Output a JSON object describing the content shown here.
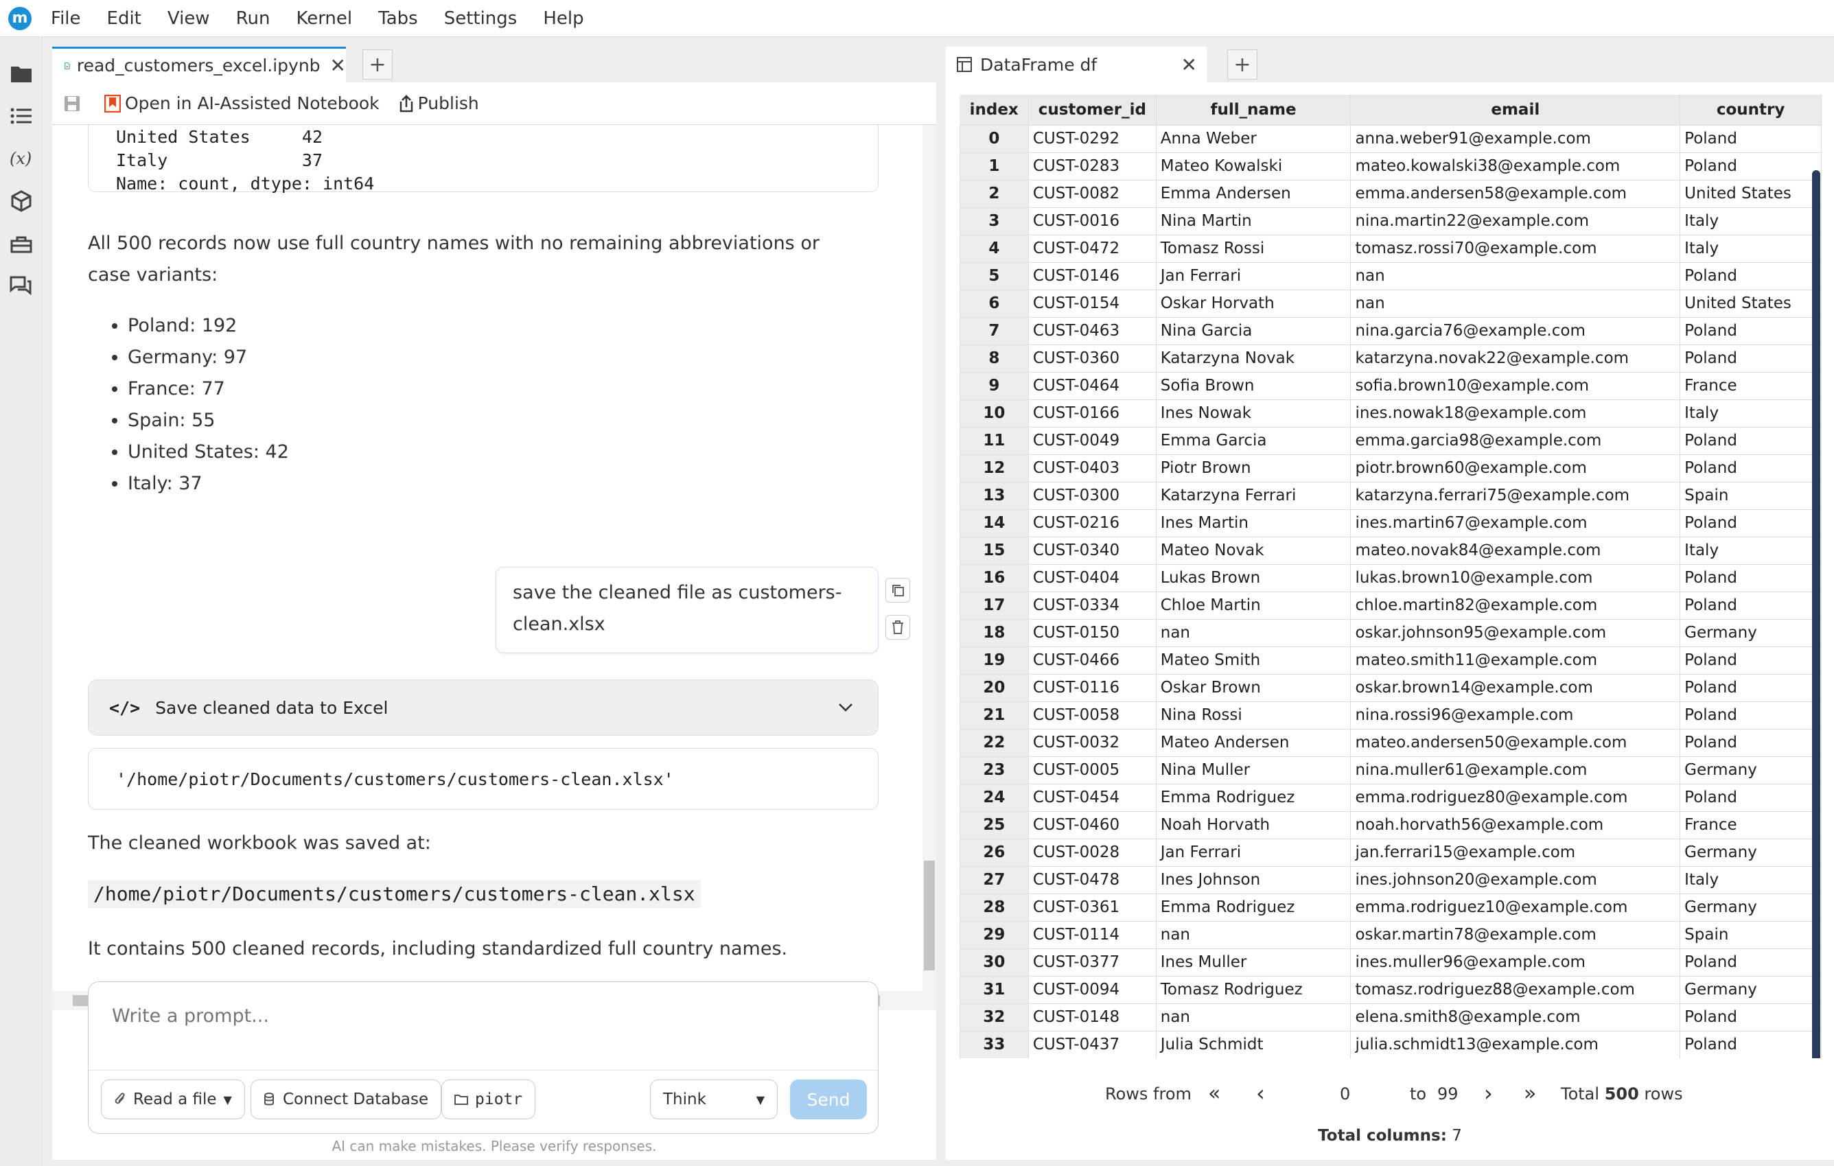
{
  "menu": [
    "File",
    "Edit",
    "View",
    "Run",
    "Kernel",
    "Tabs",
    "Settings",
    "Help"
  ],
  "logo_letter": "m",
  "notebook": {
    "tab_title": "read_customers_excel.ipynb",
    "toolbar": {
      "open_ai": "Open in AI-Assisted Notebook",
      "publish": "Publish"
    },
    "output_lines": [
      "United States     42",
      "Italy             37",
      "Name: count, dtype: int64"
    ],
    "summary": "All 500 records now use full country names with no remaining abbreviations or case variants:",
    "countries": [
      "Poland: 192",
      "Germany: 97",
      "France: 77",
      "Spain: 55",
      "United States: 42",
      "Italy: 37"
    ],
    "user_message": "save the cleaned file as customers-clean.xlsx",
    "code_cell_title": "Save cleaned data to Excel",
    "code_output": "'/home/piotr/Documents/customers/customers-clean.xlsx'",
    "saved_at_text": "The cleaned workbook was saved at:",
    "saved_path": "/home/piotr/Documents/customers/customers-clean.xlsx",
    "contains_text": "It contains 500 cleaned records, including standardized full country names.",
    "prompt_placeholder": "Write a prompt...",
    "buttons": {
      "read_file": "Read a file",
      "connect_db": "Connect Database",
      "user": "piotr",
      "think": "Think",
      "send": "Send"
    },
    "disclaimer": "AI can make mistakes. Please verify responses."
  },
  "dataframe": {
    "tab_title": "DataFrame df",
    "columns": [
      "index",
      "customer_id",
      "full_name",
      "email",
      "country"
    ],
    "rows": [
      [
        "0",
        "CUST-0292",
        "Anna Weber",
        "anna.weber91@example.com",
        "Poland"
      ],
      [
        "1",
        "CUST-0283",
        "Mateo Kowalski",
        "mateo.kowalski38@example.com",
        "Poland"
      ],
      [
        "2",
        "CUST-0082",
        "Emma Andersen",
        "emma.andersen58@example.com",
        "United States"
      ],
      [
        "3",
        "CUST-0016",
        "Nina Martin",
        "nina.martin22@example.com",
        "Italy"
      ],
      [
        "4",
        "CUST-0472",
        "Tomasz Rossi",
        "tomasz.rossi70@example.com",
        "Italy"
      ],
      [
        "5",
        "CUST-0146",
        "Jan Ferrari",
        "nan",
        "Poland"
      ],
      [
        "6",
        "CUST-0154",
        "Oskar Horvath",
        "nan",
        "United States"
      ],
      [
        "7",
        "CUST-0463",
        "Nina Garcia",
        "nina.garcia76@example.com",
        "Poland"
      ],
      [
        "8",
        "CUST-0360",
        "Katarzyna Novak",
        "katarzyna.novak22@example.com",
        "Poland"
      ],
      [
        "9",
        "CUST-0464",
        "Sofia Brown",
        "sofia.brown10@example.com",
        "France"
      ],
      [
        "10",
        "CUST-0166",
        "Ines Nowak",
        "ines.nowak18@example.com",
        "Italy"
      ],
      [
        "11",
        "CUST-0049",
        "Emma Garcia",
        "emma.garcia98@example.com",
        "Poland"
      ],
      [
        "12",
        "CUST-0403",
        "Piotr Brown",
        "piotr.brown60@example.com",
        "Poland"
      ],
      [
        "13",
        "CUST-0300",
        "Katarzyna Ferrari",
        "katarzyna.ferrari75@example.com",
        "Spain"
      ],
      [
        "14",
        "CUST-0216",
        "Ines Martin",
        "ines.martin67@example.com",
        "Poland"
      ],
      [
        "15",
        "CUST-0340",
        "Mateo Novak",
        "mateo.novak84@example.com",
        "Italy"
      ],
      [
        "16",
        "CUST-0404",
        "Lukas Brown",
        "lukas.brown10@example.com",
        "Poland"
      ],
      [
        "17",
        "CUST-0334",
        "Chloe Martin",
        "chloe.martin82@example.com",
        "Poland"
      ],
      [
        "18",
        "CUST-0150",
        "nan",
        "oskar.johnson95@example.com",
        "Germany"
      ],
      [
        "19",
        "CUST-0466",
        "Mateo Smith",
        "mateo.smith11@example.com",
        "Poland"
      ],
      [
        "20",
        "CUST-0116",
        "Oskar Brown",
        "oskar.brown14@example.com",
        "Poland"
      ],
      [
        "21",
        "CUST-0058",
        "Nina Rossi",
        "nina.rossi96@example.com",
        "Poland"
      ],
      [
        "22",
        "CUST-0032",
        "Mateo Andersen",
        "mateo.andersen50@example.com",
        "Poland"
      ],
      [
        "23",
        "CUST-0005",
        "Nina Muller",
        "nina.muller61@example.com",
        "Germany"
      ],
      [
        "24",
        "CUST-0454",
        "Emma Rodriguez",
        "emma.rodriguez80@example.com",
        "Poland"
      ],
      [
        "25",
        "CUST-0460",
        "Noah Horvath",
        "noah.horvath56@example.com",
        "France"
      ],
      [
        "26",
        "CUST-0028",
        "Jan Ferrari",
        "jan.ferrari15@example.com",
        "Germany"
      ],
      [
        "27",
        "CUST-0478",
        "Ines Johnson",
        "ines.johnson20@example.com",
        "Italy"
      ],
      [
        "28",
        "CUST-0361",
        "Emma Rodriguez",
        "emma.rodriguez10@example.com",
        "Germany"
      ],
      [
        "29",
        "CUST-0114",
        "nan",
        "oskar.martin78@example.com",
        "Spain"
      ],
      [
        "30",
        "CUST-0377",
        "Ines Muller",
        "ines.muller96@example.com",
        "Poland"
      ],
      [
        "31",
        "CUST-0094",
        "Tomasz Rodriguez",
        "tomasz.rodriguez88@example.com",
        "Germany"
      ],
      [
        "32",
        "CUST-0148",
        "nan",
        "elena.smith8@example.com",
        "Poland"
      ],
      [
        "33",
        "CUST-0437",
        "Julia Schmidt",
        "julia.schmidt13@example.com",
        "Poland"
      ]
    ],
    "pager": {
      "rows_from": "Rows from",
      "first": "«",
      "prev": "‹",
      "from_value": "0",
      "to": "to",
      "to_value": "99",
      "next": "›",
      "last": "»",
      "total_prefix": "Total",
      "total": "500",
      "total_suffix": "rows"
    },
    "total_columns_label": "Total columns:",
    "total_columns": "7"
  }
}
